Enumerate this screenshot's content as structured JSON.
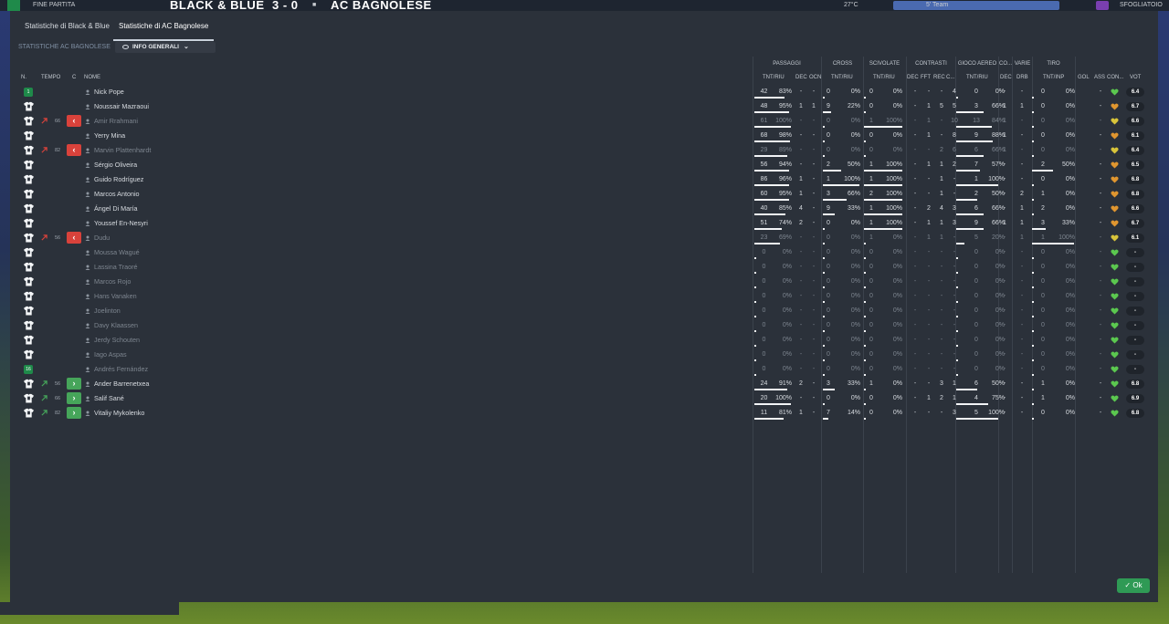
{
  "topbar": {
    "status": "FINE PARTITA",
    "home_team": "BLACK & BLUE",
    "score": "3 - 0",
    "away_team": "AC BAGNOLESE",
    "temp": "27°C",
    "squad_btn": "SFOGLIATOIO",
    "mid_label": "5' Team"
  },
  "tabs": [
    {
      "label": "Statistiche di Black & Blue",
      "active": false
    },
    {
      "label": "Statistiche di AC Bagnolese",
      "active": true
    }
  ],
  "subheader": {
    "label": "STATISTICHE AC BAGNOLESE",
    "view_select": "INFO GENERALI"
  },
  "groups": {
    "passaggi": "PASSAGGI",
    "cross": "CROSS",
    "scivolate": "SCIVOLATE",
    "contrasti": "CONTRASTI",
    "gioco_aereo": "GIOCO AEREO",
    "co": "CO...",
    "varie": "VARIE",
    "tiro": "TIRO"
  },
  "columns": {
    "n": "N.",
    "tempo": "TEMPO",
    "c": "C",
    "nome": "NOME",
    "pass_tntriu": "TNT/RIU",
    "dec": "DEC",
    "ocn": "OCN",
    "cross_tntriu": "TNT/RIU",
    "sciv_tntriu": "TNT/RIU",
    "cont_dec": "DEC",
    "cont_fft": "FFT",
    "cont_rec": "REC",
    "cont_c": "C...",
    "aereo_tntriu": "TNT/RIU",
    "co_dec": "DEC",
    "varie_drb": "DRB",
    "tiro_tntunp": "TNT/INP",
    "gol": "GOL",
    "ass": "ASS",
    "con": "CON...",
    "vot": "VOT"
  },
  "colors": {
    "panel": "#2b313a",
    "accent_green": "#2f9a55",
    "sub_out": "#d9423b",
    "sub_in": "#46a55a",
    "heart_green": "#5bc84f",
    "heart_yellow": "#d8c43a",
    "heart_orange": "#e0962f"
  },
  "players": [
    {
      "badge": "1",
      "shirt": false,
      "dir": "",
      "min": "",
      "sub": "",
      "name": "Nick Pope",
      "muted": false,
      "p_t": "42",
      "p_r": "83%",
      "p_dec": "-",
      "p_ocn": "-",
      "c_t": "0",
      "c_r": "0%",
      "s_t": "0",
      "s_r": "0%",
      "k_dec": "-",
      "k_fft": "-",
      "k_rec": "-",
      "k_c": "4",
      "a_t": "0",
      "a_r": "0%",
      "co_dec": "-",
      "drb": "-",
      "t_t": "0",
      "t_r": "0%",
      "gol": "",
      "ass": "-",
      "heart": "green",
      "vot": "6.4"
    },
    {
      "badge": "",
      "shirt": true,
      "dir": "",
      "min": "",
      "sub": "",
      "name": "Noussair Mazraoui",
      "muted": false,
      "p_t": "48",
      "p_r": "95%",
      "p_dec": "1",
      "p_ocn": "1",
      "c_t": "9",
      "c_r": "22%",
      "s_t": "0",
      "s_r": "0%",
      "k_dec": "-",
      "k_fft": "1",
      "k_rec": "5",
      "k_c": "5",
      "a_t": "3",
      "a_r": "66%",
      "co_dec": "1",
      "drb": "1",
      "t_t": "0",
      "t_r": "0%",
      "gol": "",
      "ass": "-",
      "heart": "orange",
      "vot": "6.7"
    },
    {
      "badge": "",
      "shirt": true,
      "dir": "out",
      "min": "66",
      "sub": "out",
      "name": "Amir Rrahmani",
      "muted": true,
      "p_t": "61",
      "p_r": "100%",
      "p_dec": "-",
      "p_ocn": "-",
      "c_t": "0",
      "c_r": "0%",
      "s_t": "1",
      "s_r": "100%",
      "k_dec": "-",
      "k_fft": "1",
      "k_rec": "-",
      "k_c": "10",
      "a_t": "13",
      "a_r": "84%",
      "co_dec": "1",
      "drb": "-",
      "t_t": "0",
      "t_r": "0%",
      "gol": "",
      "ass": "-",
      "heart": "yellow",
      "vot": "6.6"
    },
    {
      "badge": "",
      "shirt": true,
      "dir": "",
      "min": "",
      "sub": "",
      "name": "Yerry Mina",
      "muted": false,
      "p_t": "68",
      "p_r": "98%",
      "p_dec": "-",
      "p_ocn": "-",
      "c_t": "0",
      "c_r": "0%",
      "s_t": "0",
      "s_r": "0%",
      "k_dec": "-",
      "k_fft": "1",
      "k_rec": "-",
      "k_c": "8",
      "a_t": "9",
      "a_r": "88%",
      "co_dec": "1",
      "drb": "-",
      "t_t": "0",
      "t_r": "0%",
      "gol": "",
      "ass": "-",
      "heart": "orange",
      "vot": "6.1"
    },
    {
      "badge": "",
      "shirt": true,
      "dir": "out",
      "min": "82",
      "sub": "out",
      "name": "Marvin Plattenhardt",
      "muted": true,
      "p_t": "29",
      "p_r": "89%",
      "p_dec": "-",
      "p_ocn": "-",
      "c_t": "0",
      "c_r": "0%",
      "s_t": "0",
      "s_r": "0%",
      "k_dec": "-",
      "k_fft": "-",
      "k_rec": "2",
      "k_c": "6",
      "a_t": "6",
      "a_r": "66%",
      "co_dec": "1",
      "drb": "-",
      "t_t": "0",
      "t_r": "0%",
      "gol": "",
      "ass": "-",
      "heart": "yellow",
      "vot": "6.4"
    },
    {
      "badge": "",
      "shirt": true,
      "dir": "",
      "min": "",
      "sub": "",
      "name": "Sérgio Oliveira",
      "muted": false,
      "p_t": "56",
      "p_r": "94%",
      "p_dec": "-",
      "p_ocn": "-",
      "c_t": "2",
      "c_r": "50%",
      "s_t": "1",
      "s_r": "100%",
      "k_dec": "-",
      "k_fft": "1",
      "k_rec": "1",
      "k_c": "2",
      "a_t": "7",
      "a_r": "57%",
      "co_dec": "-",
      "drb": "-",
      "t_t": "2",
      "t_r": "50%",
      "gol": "",
      "ass": "-",
      "heart": "orange",
      "vot": "6.5"
    },
    {
      "badge": "",
      "shirt": true,
      "dir": "",
      "min": "",
      "sub": "",
      "name": "Guido Rodríguez",
      "muted": false,
      "p_t": "86",
      "p_r": "96%",
      "p_dec": "1",
      "p_ocn": "-",
      "c_t": "1",
      "c_r": "100%",
      "s_t": "1",
      "s_r": "100%",
      "k_dec": "-",
      "k_fft": "-",
      "k_rec": "1",
      "k_c": "-",
      "a_t": "1",
      "a_r": "100%",
      "co_dec": "-",
      "drb": "-",
      "t_t": "0",
      "t_r": "0%",
      "gol": "",
      "ass": "-",
      "heart": "orange",
      "vot": "6.8"
    },
    {
      "badge": "",
      "shirt": true,
      "dir": "",
      "min": "",
      "sub": "",
      "name": "Marcos Antonio",
      "muted": false,
      "p_t": "60",
      "p_r": "95%",
      "p_dec": "1",
      "p_ocn": "-",
      "c_t": "3",
      "c_r": "66%",
      "s_t": "2",
      "s_r": "100%",
      "k_dec": "-",
      "k_fft": "-",
      "k_rec": "1",
      "k_c": "-",
      "a_t": "2",
      "a_r": "50%",
      "co_dec": "-",
      "drb": "2",
      "t_t": "1",
      "t_r": "0%",
      "gol": "",
      "ass": "-",
      "heart": "orange",
      "vot": "6.8"
    },
    {
      "badge": "",
      "shirt": true,
      "dir": "",
      "min": "",
      "sub": "",
      "name": "Ángel Di María",
      "muted": false,
      "p_t": "40",
      "p_r": "85%",
      "p_dec": "4",
      "p_ocn": "-",
      "c_t": "9",
      "c_r": "33%",
      "s_t": "1",
      "s_r": "100%",
      "k_dec": "-",
      "k_fft": "2",
      "k_rec": "4",
      "k_c": "3",
      "a_t": "6",
      "a_r": "66%",
      "co_dec": "-",
      "drb": "1",
      "t_t": "2",
      "t_r": "0%",
      "gol": "",
      "ass": "-",
      "heart": "orange",
      "vot": "6.6"
    },
    {
      "badge": "",
      "shirt": true,
      "dir": "",
      "min": "",
      "sub": "",
      "name": "Youssef En-Nesyri",
      "muted": false,
      "p_t": "51",
      "p_r": "74%",
      "p_dec": "2",
      "p_ocn": "-",
      "c_t": "0",
      "c_r": "0%",
      "s_t": "1",
      "s_r": "100%",
      "k_dec": "-",
      "k_fft": "1",
      "k_rec": "1",
      "k_c": "3",
      "a_t": "9",
      "a_r": "66%",
      "co_dec": "1",
      "drb": "1",
      "t_t": "3",
      "t_r": "33%",
      "gol": "",
      "ass": "-",
      "heart": "orange",
      "vot": "6.7"
    },
    {
      "badge": "",
      "shirt": true,
      "dir": "out",
      "min": "56",
      "sub": "out",
      "name": "Dudu",
      "muted": true,
      "p_t": "23",
      "p_r": "69%",
      "p_dec": "-",
      "p_ocn": "-",
      "c_t": "0",
      "c_r": "0%",
      "s_t": "1",
      "s_r": "0%",
      "k_dec": "-",
      "k_fft": "1",
      "k_rec": "1",
      "k_c": "-",
      "a_t": "5",
      "a_r": "20%",
      "co_dec": "-",
      "drb": "1",
      "t_t": "1",
      "t_r": "100%",
      "gol": "",
      "ass": "-",
      "heart": "yellow",
      "vot": "6.1"
    },
    {
      "badge": "",
      "shirt": true,
      "dir": "",
      "min": "",
      "sub": "",
      "name": "Moussa Wagué",
      "muted": true,
      "p_t": "0",
      "p_r": "0%",
      "p_dec": "-",
      "p_ocn": "-",
      "c_t": "0",
      "c_r": "0%",
      "s_t": "0",
      "s_r": "0%",
      "k_dec": "-",
      "k_fft": "-",
      "k_rec": "-",
      "k_c": "-",
      "a_t": "0",
      "a_r": "0%",
      "co_dec": "-",
      "drb": "-",
      "t_t": "0",
      "t_r": "0%",
      "gol": "",
      "ass": "-",
      "heart": "green",
      "vot": "-"
    },
    {
      "badge": "",
      "shirt": true,
      "dir": "",
      "min": "",
      "sub": "",
      "name": "Lassina Traoré",
      "muted": true,
      "p_t": "0",
      "p_r": "0%",
      "p_dec": "-",
      "p_ocn": "-",
      "c_t": "0",
      "c_r": "0%",
      "s_t": "0",
      "s_r": "0%",
      "k_dec": "-",
      "k_fft": "-",
      "k_rec": "-",
      "k_c": "-",
      "a_t": "0",
      "a_r": "0%",
      "co_dec": "-",
      "drb": "-",
      "t_t": "0",
      "t_r": "0%",
      "gol": "",
      "ass": "-",
      "heart": "green",
      "vot": "-"
    },
    {
      "badge": "",
      "shirt": true,
      "dir": "",
      "min": "",
      "sub": "",
      "name": "Marcos Rojo",
      "muted": true,
      "p_t": "0",
      "p_r": "0%",
      "p_dec": "-",
      "p_ocn": "-",
      "c_t": "0",
      "c_r": "0%",
      "s_t": "0",
      "s_r": "0%",
      "k_dec": "-",
      "k_fft": "-",
      "k_rec": "-",
      "k_c": "-",
      "a_t": "0",
      "a_r": "0%",
      "co_dec": "-",
      "drb": "-",
      "t_t": "0",
      "t_r": "0%",
      "gol": "",
      "ass": "-",
      "heart": "green",
      "vot": "-"
    },
    {
      "badge": "",
      "shirt": true,
      "dir": "",
      "min": "",
      "sub": "",
      "name": "Hans Vanaken",
      "muted": true,
      "p_t": "0",
      "p_r": "0%",
      "p_dec": "-",
      "p_ocn": "-",
      "c_t": "0",
      "c_r": "0%",
      "s_t": "0",
      "s_r": "0%",
      "k_dec": "-",
      "k_fft": "-",
      "k_rec": "-",
      "k_c": "-",
      "a_t": "0",
      "a_r": "0%",
      "co_dec": "-",
      "drb": "-",
      "t_t": "0",
      "t_r": "0%",
      "gol": "",
      "ass": "-",
      "heart": "green",
      "vot": "-"
    },
    {
      "badge": "",
      "shirt": true,
      "dir": "",
      "min": "",
      "sub": "",
      "name": "Joelinton",
      "muted": true,
      "p_t": "0",
      "p_r": "0%",
      "p_dec": "-",
      "p_ocn": "-",
      "c_t": "0",
      "c_r": "0%",
      "s_t": "0",
      "s_r": "0%",
      "k_dec": "-",
      "k_fft": "-",
      "k_rec": "-",
      "k_c": "-",
      "a_t": "0",
      "a_r": "0%",
      "co_dec": "-",
      "drb": "-",
      "t_t": "0",
      "t_r": "0%",
      "gol": "",
      "ass": "-",
      "heart": "green",
      "vot": "-"
    },
    {
      "badge": "",
      "shirt": true,
      "dir": "",
      "min": "",
      "sub": "",
      "name": "Davy Klaassen",
      "muted": true,
      "p_t": "0",
      "p_r": "0%",
      "p_dec": "-",
      "p_ocn": "-",
      "c_t": "0",
      "c_r": "0%",
      "s_t": "0",
      "s_r": "0%",
      "k_dec": "-",
      "k_fft": "-",
      "k_rec": "-",
      "k_c": "-",
      "a_t": "0",
      "a_r": "0%",
      "co_dec": "-",
      "drb": "-",
      "t_t": "0",
      "t_r": "0%",
      "gol": "",
      "ass": "-",
      "heart": "green",
      "vot": "-"
    },
    {
      "badge": "",
      "shirt": true,
      "dir": "",
      "min": "",
      "sub": "",
      "name": "Jerdy Schouten",
      "muted": true,
      "p_t": "0",
      "p_r": "0%",
      "p_dec": "-",
      "p_ocn": "-",
      "c_t": "0",
      "c_r": "0%",
      "s_t": "0",
      "s_r": "0%",
      "k_dec": "-",
      "k_fft": "-",
      "k_rec": "-",
      "k_c": "-",
      "a_t": "0",
      "a_r": "0%",
      "co_dec": "-",
      "drb": "-",
      "t_t": "0",
      "t_r": "0%",
      "gol": "",
      "ass": "-",
      "heart": "green",
      "vot": "-"
    },
    {
      "badge": "",
      "shirt": true,
      "dir": "",
      "min": "",
      "sub": "",
      "name": "Iago Aspas",
      "muted": true,
      "p_t": "0",
      "p_r": "0%",
      "p_dec": "-",
      "p_ocn": "-",
      "c_t": "0",
      "c_r": "0%",
      "s_t": "0",
      "s_r": "0%",
      "k_dec": "-",
      "k_fft": "-",
      "k_rec": "-",
      "k_c": "-",
      "a_t": "0",
      "a_r": "0%",
      "co_dec": "-",
      "drb": "-",
      "t_t": "0",
      "t_r": "0%",
      "gol": "",
      "ass": "-",
      "heart": "green",
      "vot": "-"
    },
    {
      "badge": "16",
      "shirt": false,
      "dir": "",
      "min": "",
      "sub": "",
      "name": "Andrés Fernández",
      "muted": true,
      "p_t": "0",
      "p_r": "0%",
      "p_dec": "-",
      "p_ocn": "-",
      "c_t": "0",
      "c_r": "0%",
      "s_t": "0",
      "s_r": "0%",
      "k_dec": "-",
      "k_fft": "-",
      "k_rec": "-",
      "k_c": "-",
      "a_t": "0",
      "a_r": "0%",
      "co_dec": "-",
      "drb": "-",
      "t_t": "0",
      "t_r": "0%",
      "gol": "",
      "ass": "-",
      "heart": "green",
      "vot": "-"
    },
    {
      "badge": "",
      "shirt": true,
      "dir": "in",
      "min": "56",
      "sub": "in",
      "name": "Ander Barrenetxea",
      "muted": false,
      "p_t": "24",
      "p_r": "91%",
      "p_dec": "2",
      "p_ocn": "-",
      "c_t": "3",
      "c_r": "33%",
      "s_t": "1",
      "s_r": "0%",
      "k_dec": "-",
      "k_fft": "-",
      "k_rec": "3",
      "k_c": "1",
      "a_t": "6",
      "a_r": "50%",
      "co_dec": "-",
      "drb": "-",
      "t_t": "1",
      "t_r": "0%",
      "gol": "",
      "ass": "-",
      "heart": "green",
      "vot": "6.8"
    },
    {
      "badge": "",
      "shirt": true,
      "dir": "in",
      "min": "66",
      "sub": "in",
      "name": "Salif Sané",
      "muted": false,
      "p_t": "20",
      "p_r": "100%",
      "p_dec": "-",
      "p_ocn": "-",
      "c_t": "0",
      "c_r": "0%",
      "s_t": "0",
      "s_r": "0%",
      "k_dec": "-",
      "k_fft": "1",
      "k_rec": "2",
      "k_c": "1",
      "a_t": "4",
      "a_r": "75%",
      "co_dec": "-",
      "drb": "-",
      "t_t": "1",
      "t_r": "0%",
      "gol": "",
      "ass": "-",
      "heart": "green",
      "vot": "6.9"
    },
    {
      "badge": "",
      "shirt": true,
      "dir": "in",
      "min": "82",
      "sub": "in",
      "name": "Vitaliy Mykolenko",
      "muted": false,
      "p_t": "11",
      "p_r": "81%",
      "p_dec": "1",
      "p_ocn": "-",
      "c_t": "7",
      "c_r": "14%",
      "s_t": "0",
      "s_r": "0%",
      "k_dec": "-",
      "k_fft": "-",
      "k_rec": "-",
      "k_c": "3",
      "a_t": "5",
      "a_r": "100%",
      "co_dec": "-",
      "drb": "-",
      "t_t": "0",
      "t_r": "0%",
      "gol": "",
      "ass": "-",
      "heart": "green",
      "vot": "6.8"
    }
  ],
  "ok_label": "Ok"
}
